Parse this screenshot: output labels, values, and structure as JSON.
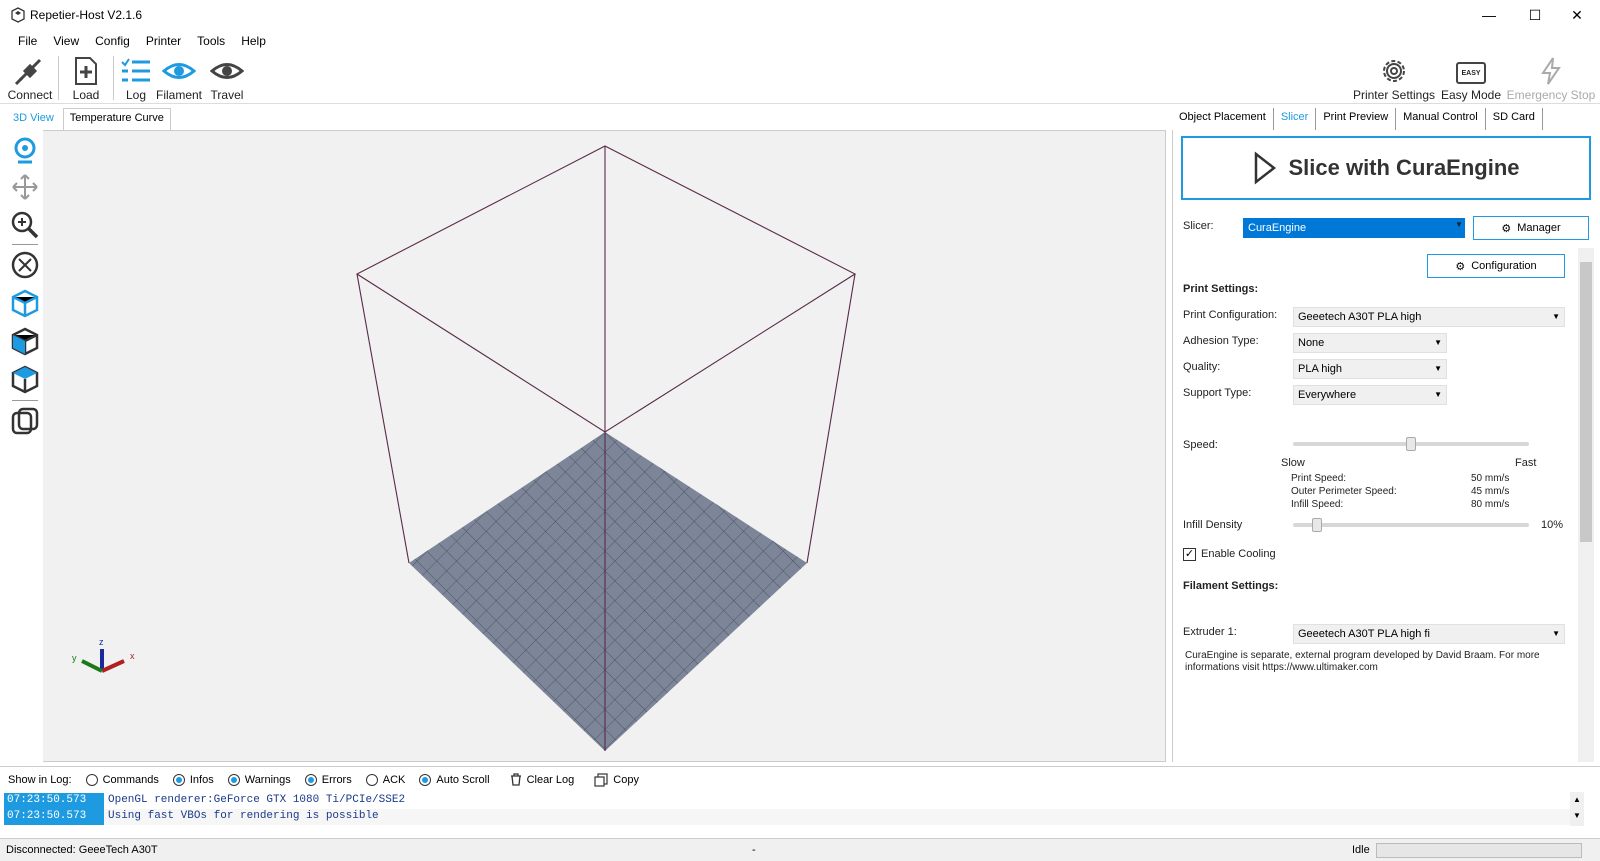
{
  "window": {
    "title": "Repetier-Host V2.1.6"
  },
  "menu": [
    "File",
    "View",
    "Config",
    "Printer",
    "Tools",
    "Help"
  ],
  "toolbar": {
    "connect": "Connect",
    "load": "Load",
    "log": "Log",
    "filament": "Filament",
    "travel": "Travel",
    "printer_settings": "Printer Settings",
    "easy_mode": "Easy Mode",
    "emergency_stop": "Emergency Stop",
    "easy_badge": "EASY"
  },
  "view_tabs": [
    "3D View",
    "Temperature Curve"
  ],
  "right_tabs": [
    "Object Placement",
    "Slicer",
    "Print Preview",
    "Manual Control",
    "SD Card"
  ],
  "slicer": {
    "slice_button": "Slice with CuraEngine",
    "slicer_label": "Slicer:",
    "slicer_value": "CuraEngine",
    "manager_button": "Manager",
    "configuration_button": "Configuration",
    "print_settings_header": "Print Settings:",
    "print_configuration_label": "Print Configuration:",
    "print_configuration_value": "Geeetech A30T PLA high",
    "adhesion_label": "Adhesion Type:",
    "adhesion_value": "None",
    "quality_label": "Quality:",
    "quality_value": "PLA high",
    "support_label": "Support Type:",
    "support_value": "Everywhere",
    "speed_label": "Speed:",
    "speed_level": 0.5,
    "slow_label": "Slow",
    "fast_label": "Fast",
    "print_speed_label": "Print Speed:",
    "print_speed_value": "50 mm/s",
    "outer_perimeter_label": "Outer Perimeter Speed:",
    "outer_perimeter_value": "45 mm/s",
    "infill_speed_label": "Infill Speed:",
    "infill_speed_value": "80 mm/s",
    "infill_density_label": "Infill Density",
    "infill_density_value": "10%",
    "enable_cooling_label": "Enable Cooling",
    "filament_settings_header": "Filament Settings:",
    "extruder_label": "Extruder 1:",
    "extruder_value": "Geeetech A30T PLA high fi",
    "footnote": "CuraEngine is separate, external program developed by David Braam. For more informations visit https://www.ultimaker.com"
  },
  "log": {
    "show_in_log_label": "Show in Log:",
    "options": [
      {
        "label": "Commands",
        "checked": false
      },
      {
        "label": "Infos",
        "checked": true
      },
      {
        "label": "Warnings",
        "checked": true
      },
      {
        "label": "Errors",
        "checked": true
      },
      {
        "label": "ACK",
        "checked": false
      },
      {
        "label": "Auto Scroll",
        "checked": true
      }
    ],
    "clear_log": "Clear Log",
    "copy": "Copy",
    "lines": [
      {
        "time": "07:23:50.573",
        "text": "OpenGL renderer:GeForce GTX 1080 Ti/PCIe/SSE2"
      },
      {
        "time": "07:23:50.573",
        "text": "Using fast VBOs for rendering is possible"
      }
    ]
  },
  "status": {
    "left": "Disconnected: GeeeTech A30T",
    "middle": "-",
    "right": "Idle"
  },
  "colors": {
    "accent": "#1e9be0",
    "bed": "#7d8599",
    "box_edges": "#5a2a4a"
  }
}
